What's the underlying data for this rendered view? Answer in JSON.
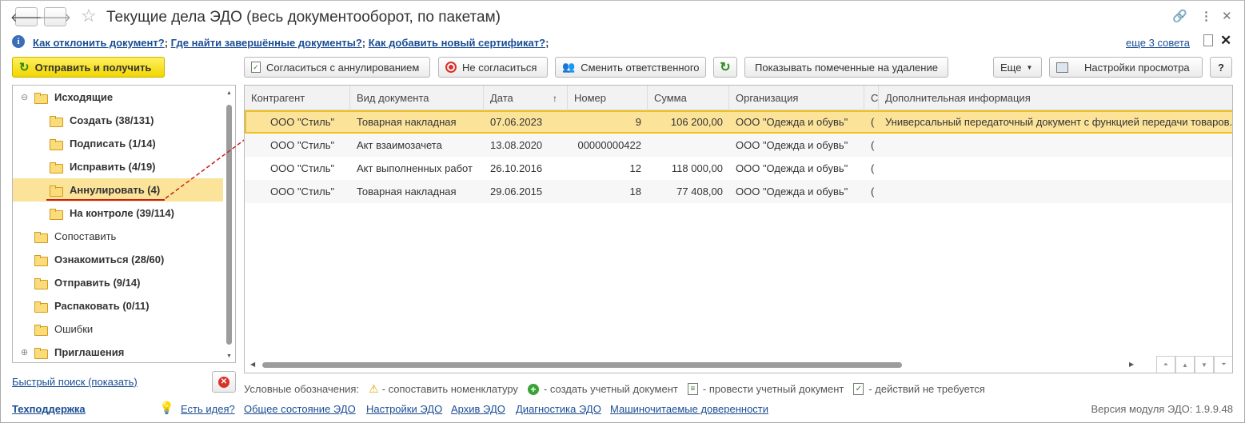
{
  "window": {
    "title": "Текущие дела ЭДО (весь документооборот, по пакетам)"
  },
  "hints": {
    "links": [
      "Как отклонить документ?",
      "Где найти завершённые документы?",
      "Как добавить новый сертификат?"
    ],
    "more": "еще 3 совета"
  },
  "toolbar": {
    "send_receive": "Отправить и получить",
    "agree_cancel": "Согласиться с аннулированием",
    "disagree": "Не согласиться",
    "change_responsible": "Сменить ответственного",
    "show_deleted": "Показывать помеченные на удаление",
    "more": "Еще",
    "view_settings": "Настройки просмотра",
    "help": "?"
  },
  "tree": {
    "items": [
      {
        "label": "Исходящие",
        "bold": true,
        "level": 0,
        "expand": "⊖"
      },
      {
        "label": "Создать (38/131)",
        "bold": true,
        "level": 1
      },
      {
        "label": "Подписать (1/14)",
        "bold": true,
        "level": 1
      },
      {
        "label": "Исправить (4/19)",
        "bold": true,
        "level": 1
      },
      {
        "label": "Аннулировать (4)",
        "bold": true,
        "level": 1,
        "selected": true
      },
      {
        "label": "На контроле (39/114)",
        "bold": true,
        "level": 1
      },
      {
        "label": "Сопоставить",
        "bold": false,
        "level": 0
      },
      {
        "label": "Ознакомиться (28/60)",
        "bold": true,
        "level": 0
      },
      {
        "label": "Отправить (9/14)",
        "bold": true,
        "level": 0
      },
      {
        "label": "Распаковать (0/11)",
        "bold": true,
        "level": 0
      },
      {
        "label": "Ошибки",
        "bold": false,
        "level": 0
      },
      {
        "label": "Приглашения",
        "bold": true,
        "level": 0,
        "expand": "⊕"
      }
    ]
  },
  "quick_search": "Быстрый поиск (показать)",
  "table": {
    "columns": [
      "Контрагент",
      "Вид документа",
      "Дата",
      "Номер",
      "Сумма",
      "Организация",
      "С",
      "Дополнительная информация"
    ],
    "sort_indicator": "↑",
    "rows": [
      {
        "contractor": "ООО \"Стиль\"",
        "doc_type": "Товарная накладная",
        "date": "07.06.2023",
        "number": "9",
        "sum": "106 200,00",
        "org": "ООО \"Одежда и обувь\"",
        "s": "(",
        "info": "Универсальный передаточный документ с функцией передачи товаров...",
        "selected": true
      },
      {
        "contractor": "ООО \"Стиль\"",
        "doc_type": "Акт взаимозачета",
        "date": "13.08.2020",
        "number": "00000000422",
        "sum": "",
        "org": "ООО \"Одежда и обувь\"",
        "s": "(",
        "info": ""
      },
      {
        "contractor": "ООО \"Стиль\"",
        "doc_type": "Акт выполненных работ",
        "date": "26.10.2016",
        "number": "12",
        "sum": "118 000,00",
        "org": "ООО \"Одежда и обувь\"",
        "s": "(",
        "info": ""
      },
      {
        "contractor": "ООО \"Стиль\"",
        "doc_type": "Товарная накладная",
        "date": "29.06.2015",
        "number": "18",
        "sum": "77 408,00",
        "org": "ООО \"Одежда и обувь\"",
        "s": "(",
        "info": ""
      }
    ]
  },
  "legend": {
    "title": "Условные обозначения:",
    "items": [
      "- сопоставить номенклатуру",
      "- создать учетный документ",
      "- провести учетный документ",
      "- действий не требуется"
    ]
  },
  "footer": {
    "support": "Техподдержка",
    "links": [
      "Есть идея?",
      "Общее состояние ЭДО",
      "Настройки ЭДО",
      "Архив ЭДО",
      "Диагностика ЭДО",
      "Машиночитаемые доверенности"
    ],
    "version": "Версия модуля ЭДО: 1.9.9.48"
  },
  "colors": {
    "accent_yellow": "#f1d600",
    "selection": "#fce39a",
    "link": "#1a4d94",
    "annotation_red": "#c8201a"
  }
}
